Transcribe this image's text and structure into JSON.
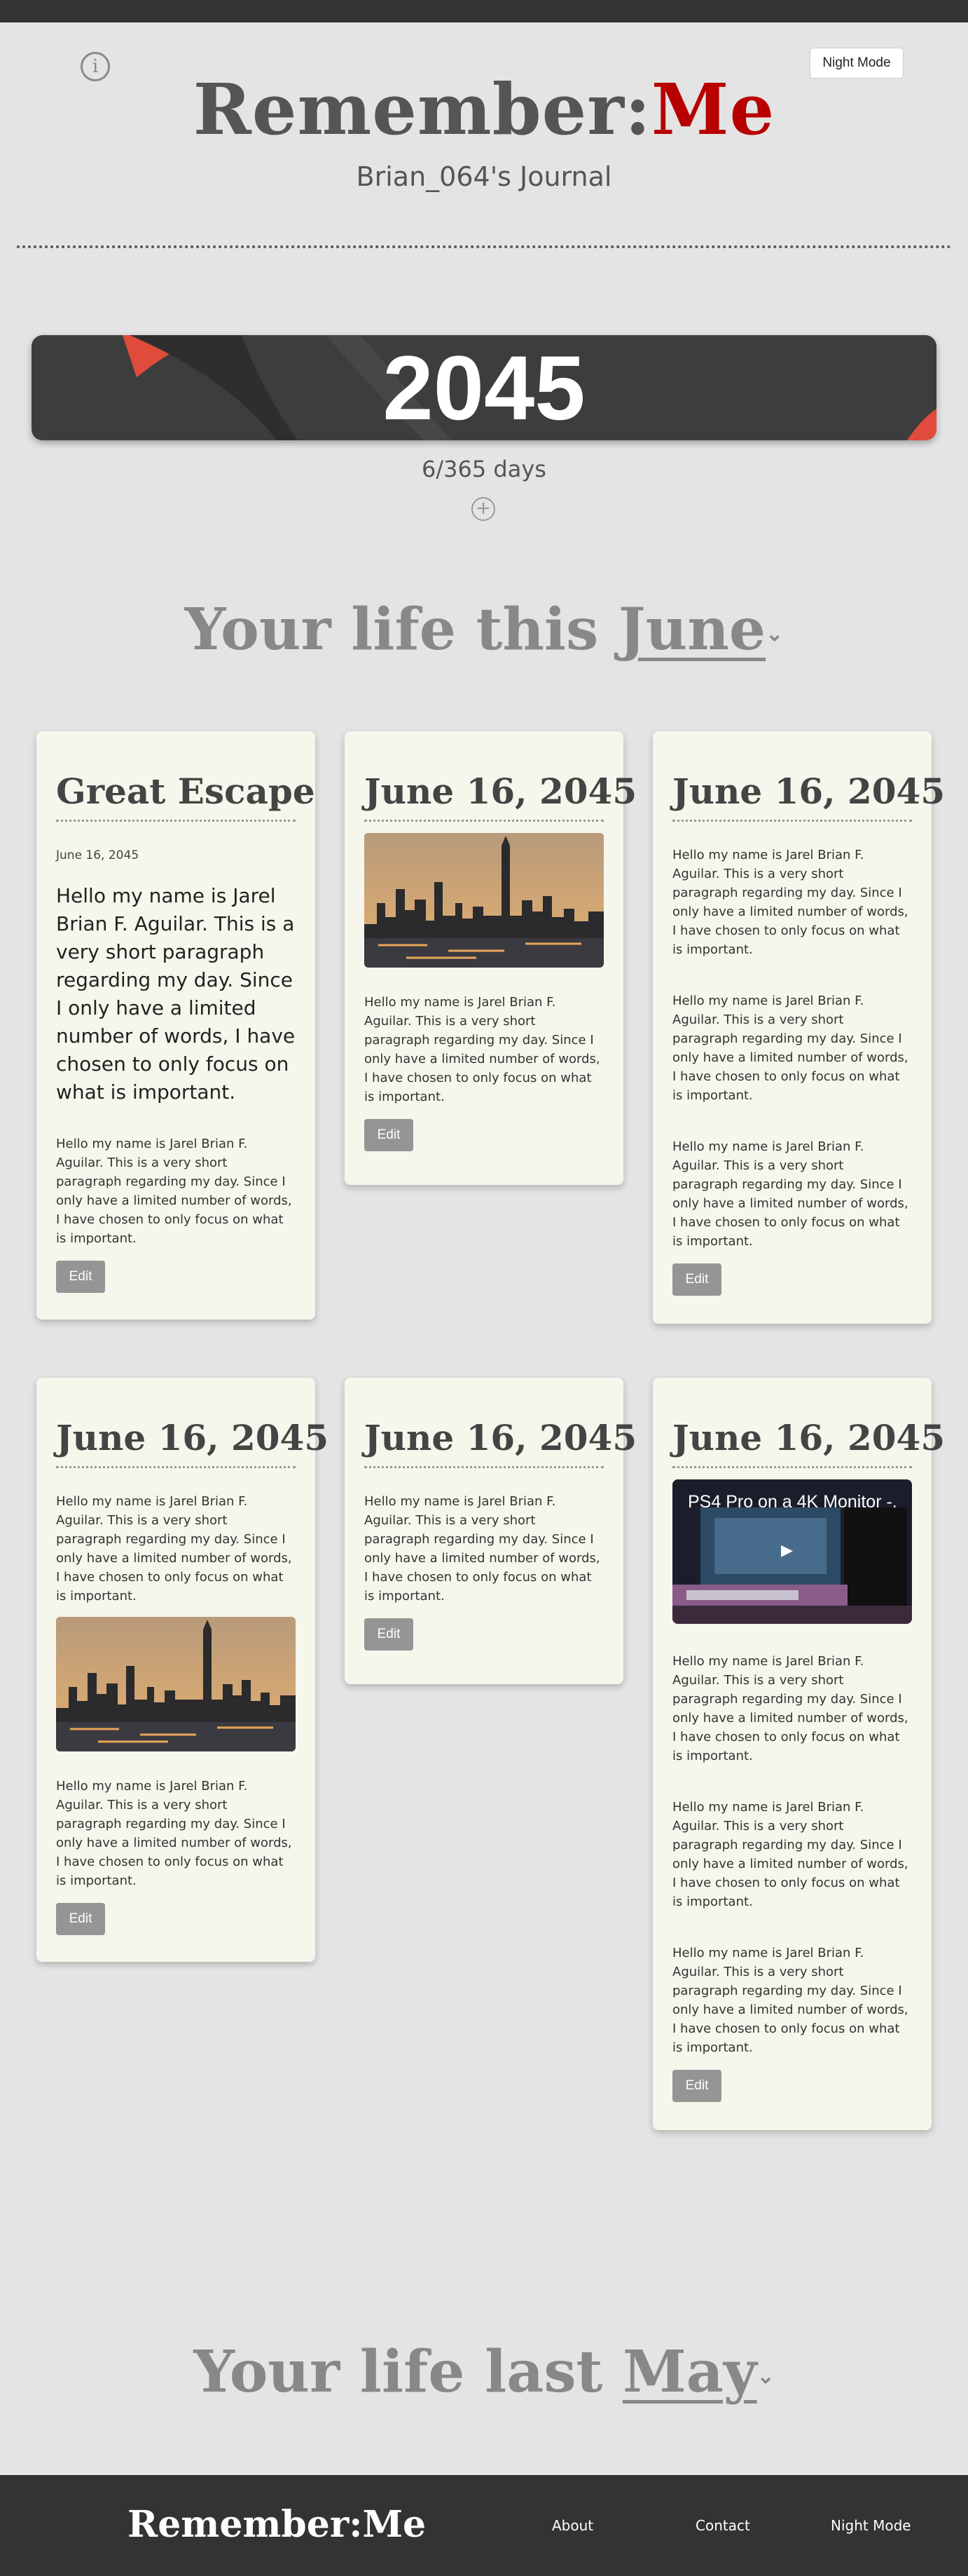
{
  "app": {
    "brand_main": "Remember:",
    "brand_accent": "Me",
    "journal_title": "Brian_064's Journal",
    "night_mode_label": "Night Mode",
    "info_icon": "info-circle-icon"
  },
  "year": {
    "value": "2045",
    "days_label": "6/365 days",
    "add_icon": "plus-circle-icon"
  },
  "this_month": {
    "prefix": "Your life this ",
    "month": "June",
    "caret": "⌄"
  },
  "last_month": {
    "prefix": "Your life last ",
    "month": "May",
    "caret": "⌄"
  },
  "cards": {
    "c1": {
      "title": "Great Escape",
      "date": "June 16, 2045",
      "lead": "Hello my name is Jarel Brian F. Aguilar. This is a very short paragraph regarding my day. Since I only have a limited number of words, I have chosen to only focus on what is important.",
      "text": "Hello my name is Jarel Brian F. Aguilar. This is a very short paragraph regarding my day. Since I only have a limited number of words, I have chosen to only focus on what is important.",
      "edit": "Edit"
    },
    "c2": {
      "title": "June 16, 2045",
      "image": "city-skyline-photo",
      "text": "Hello my name is Jarel Brian F. Aguilar. This is a very short paragraph regarding my day. Since I only have a limited number of words, I have chosen to only focus on what is important.",
      "edit": "Edit"
    },
    "c3": {
      "title": "June 16, 2045",
      "text1": "Hello my name is Jarel Brian F. Aguilar. This is a very short paragraph regarding my day. Since I only have a limited number of words, I have chosen to only focus on what is important.",
      "text2": "Hello my name is Jarel Brian F. Aguilar. This is a very short paragraph regarding my day. Since I only have a limited number of words, I have chosen to only focus on what is important.",
      "text3": "Hello my name is Jarel Brian F. Aguilar. This is a very short paragraph regarding my day. Since I only have a limited number of words, I have chosen to only focus on what is important.",
      "edit": "Edit"
    },
    "c4": {
      "title": "June 16, 2045",
      "text1": "Hello my name is Jarel Brian F. Aguilar. This is a very short paragraph regarding my day. Since I only have a limited number of words, I have chosen to only focus on what is important.",
      "image": "city-skyline-photo",
      "text2": "Hello my name is Jarel Brian F. Aguilar. This is a very short paragraph regarding my day. Since I only have a limited number of words, I have chosen to only focus on what is important.",
      "edit": "Edit"
    },
    "c5": {
      "title": "June 16, 2045",
      "text": "Hello my name is Jarel Brian F. Aguilar. This is a very short paragraph regarding my day. Since I only have a limited number of words, I have chosen to only focus on what is important.",
      "edit": "Edit"
    },
    "c6": {
      "title": "June 16, 2045",
      "video_title": "PS4 Pro on a 4K Monitor -...",
      "text1": "Hello my name is Jarel Brian F. Aguilar. This is a very short paragraph regarding my day. Since I only have a limited number of words, I have chosen to only focus on what is important.",
      "text2": "Hello my name is Jarel Brian F. Aguilar. This is a very short paragraph regarding my day. Since I only have a limited number of words, I have chosen to only focus on what is important.",
      "text3": "Hello my name is Jarel Brian F. Aguilar. This is a very short paragraph regarding my day. Since I only have a limited number of words, I have chosen to only focus on what is important.",
      "edit": "Edit"
    }
  },
  "footer": {
    "brand": "Remember:Me",
    "links": [
      "About",
      "Contact",
      "Night Mode"
    ]
  },
  "colors": {
    "background": "#e4e4e4",
    "dark_bar": "#333333",
    "brand_accent": "#b80000",
    "card_bg": "#f6f6ec",
    "banner_accent": "#e14b3b"
  }
}
